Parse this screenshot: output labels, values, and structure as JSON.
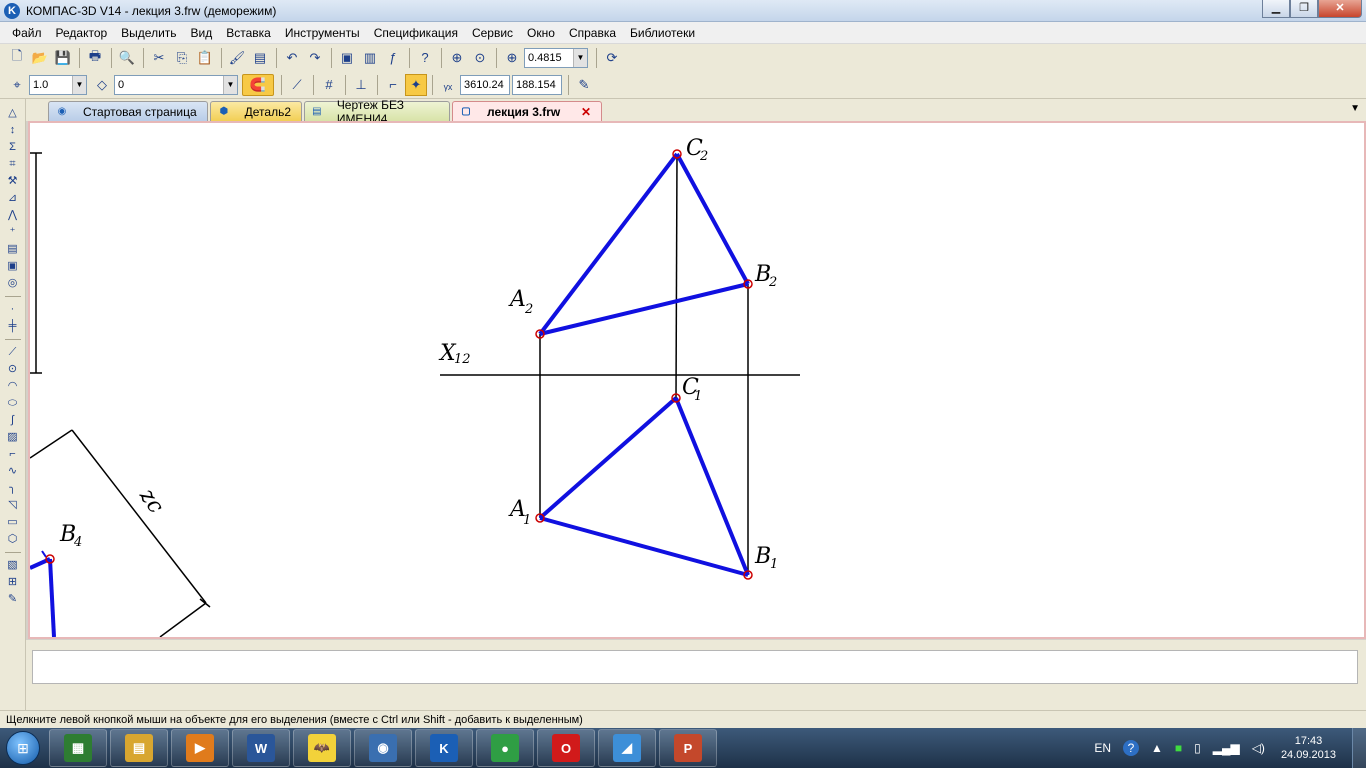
{
  "window": {
    "title": "КОМПАС-3D V14 - лекция 3.frw (деморежим)",
    "app_icon_letter": "K",
    "minimize": "▁",
    "maximize": "❐",
    "close": "✕"
  },
  "menu": [
    "Файл",
    "Редактор",
    "Выделить",
    "Вид",
    "Вставка",
    "Инструменты",
    "Спецификация",
    "Сервис",
    "Окно",
    "Справка",
    "Библиотеки"
  ],
  "toolbar1": {
    "zoom_value": "0.4815"
  },
  "toolbar2": {
    "step_value": "1.0",
    "layer_value": "0",
    "coord_x": "3610.24",
    "coord_y": "188.154"
  },
  "tabs": [
    {
      "label": "Стартовая страница"
    },
    {
      "label": "Деталь2"
    },
    {
      "label": "Чертеж БЕЗ ИМЕНИ4"
    },
    {
      "label": "лекция 3.frw",
      "close": "✕"
    }
  ],
  "drawing": {
    "labels": {
      "c2": "C",
      "c2_sub": "2",
      "b2": "B",
      "b2_sub": "2",
      "a2": "A",
      "a2_sub": "2",
      "x12": "X",
      "x12_sub": "12",
      "c1": "C",
      "c1_sub": "1",
      "a1": "A",
      "a1_sub": "1",
      "b1": "B",
      "b1_sub": "1",
      "b4": "B",
      "b4_sub": "4",
      "z": "zc"
    },
    "colors": {
      "edge": "#1010e0",
      "point": "#cc0000",
      "line": "#000000"
    }
  },
  "status_text": "Щелкните левой кнопкой мыши на объекте для его выделения (вместе с Ctrl или Shift - добавить к выделенным)",
  "taskbar": {
    "apps": [
      {
        "icon": "task-manager-icon",
        "text": "▦",
        "color": "#2e7d32"
      },
      {
        "icon": "explorer-icon",
        "text": "▤",
        "color": "#d8a630"
      },
      {
        "icon": "media-player-icon",
        "text": "▶",
        "color": "#e07b1c"
      },
      {
        "icon": "word-icon",
        "text": "W",
        "color": "#2a5699"
      },
      {
        "icon": "bat-icon",
        "text": "🦇",
        "color": "#f2d23a"
      },
      {
        "icon": "media-center-icon",
        "text": "◉",
        "color": "#3a6fb0"
      },
      {
        "icon": "kompas-icon",
        "text": "K",
        "color": "#1b5fb5"
      },
      {
        "icon": "chrome-icon",
        "text": "●",
        "color": "#2f9e44"
      },
      {
        "icon": "opera-icon",
        "text": "O",
        "color": "#d11a1a"
      },
      {
        "icon": "draw-app-icon",
        "text": "◢",
        "color": "#3d8fd8"
      },
      {
        "icon": "powerpoint-icon",
        "text": "P",
        "color": "#c4482b"
      }
    ],
    "tray": {
      "lang": "EN",
      "help": "?",
      "time": "17:43",
      "date": "24.09.2013"
    }
  }
}
